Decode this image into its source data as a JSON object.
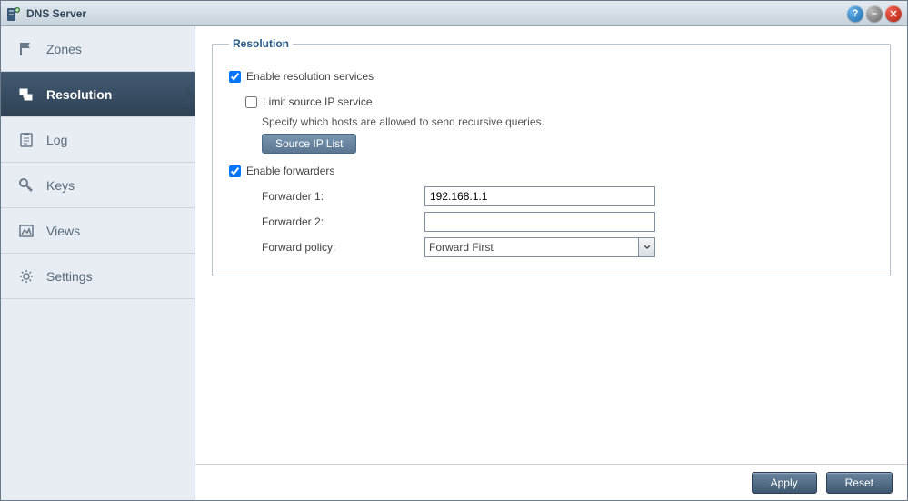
{
  "window": {
    "title": "DNS Server"
  },
  "sidebar": {
    "items": [
      {
        "label": "Zones",
        "icon": "flag-icon"
      },
      {
        "label": "Resolution",
        "icon": "resolution-icon",
        "active": true
      },
      {
        "label": "Log",
        "icon": "clipboard-icon"
      },
      {
        "label": "Keys",
        "icon": "key-icon"
      },
      {
        "label": "Views",
        "icon": "views-icon"
      },
      {
        "label": "Settings",
        "icon": "gear-icon"
      }
    ]
  },
  "panel": {
    "legend": "Resolution",
    "enable_resolution": {
      "label": "Enable resolution services",
      "checked": true
    },
    "limit_source": {
      "label": "Limit source IP service",
      "checked": false,
      "help": "Specify which hosts are allowed to send recursive queries.",
      "button": "Source IP List"
    },
    "enable_forwarders": {
      "label": "Enable forwarders",
      "checked": true
    },
    "forwarder1": {
      "label": "Forwarder 1:",
      "value": "192.168.1.1"
    },
    "forwarder2": {
      "label": "Forwarder 2:",
      "value": ""
    },
    "forward_policy": {
      "label": "Forward policy:",
      "value": "Forward First"
    }
  },
  "footer": {
    "apply": "Apply",
    "reset": "Reset"
  }
}
